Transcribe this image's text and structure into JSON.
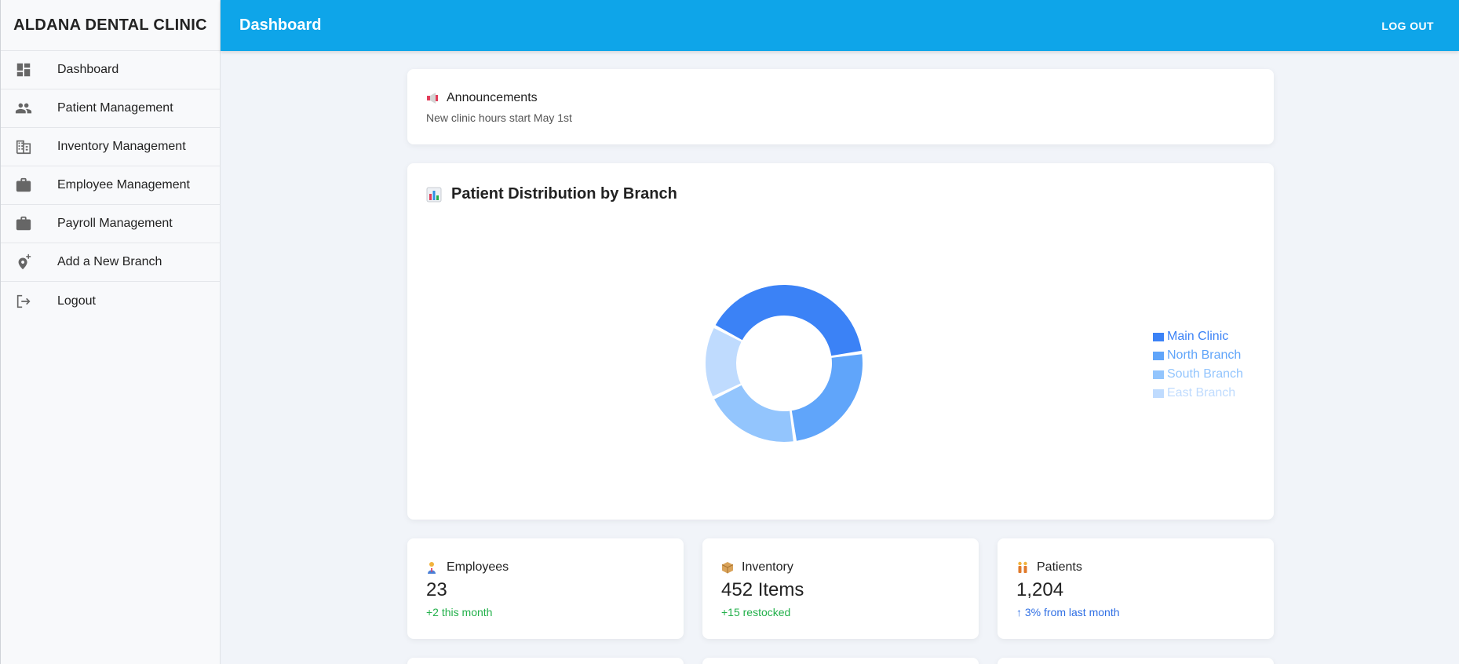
{
  "sidebar": {
    "brand": "ALDANA DENTAL CLINIC",
    "items": [
      {
        "label": "Dashboard",
        "icon": "dashboard-icon"
      },
      {
        "label": "Patient Management",
        "icon": "people-icon"
      },
      {
        "label": "Inventory Management",
        "icon": "building-icon"
      },
      {
        "label": "Employee Management",
        "icon": "briefcase-icon"
      },
      {
        "label": "Payroll Management",
        "icon": "briefcase-icon"
      },
      {
        "label": "Add a New Branch",
        "icon": "add-location-icon"
      },
      {
        "label": "Logout",
        "icon": "logout-icon"
      }
    ]
  },
  "topbar": {
    "title": "Dashboard",
    "logout_label": "LOG OUT",
    "color": "#0ea5e9"
  },
  "announcement": {
    "heading": "Announcements",
    "icon": "megaphone-icon",
    "text": "New clinic hours start May 1st"
  },
  "chart_data": {
    "type": "pie",
    "variant": "donut",
    "title": "Patient Distribution by Branch",
    "categories": [
      "Main Clinic",
      "North Branch",
      "South Branch",
      "East Branch"
    ],
    "values": [
      40,
      25,
      20,
      15
    ],
    "colors": [
      "#3b82f6",
      "#60a5fa",
      "#93c5fd",
      "#bfdbfe"
    ],
    "legend_position": "right"
  },
  "stats": {
    "employees": {
      "label": "Employees",
      "icon": "person-icon",
      "value": "23",
      "sub": "+2 this month",
      "sub_color": "#22b04a"
    },
    "inventory": {
      "label": "Inventory",
      "icon": "package-icon",
      "value": "452 Items",
      "sub": "+15 restocked",
      "sub_color": "#22b04a"
    },
    "patients": {
      "label": "Patients",
      "icon": "people-icon",
      "value": "1,204",
      "sub": "↑ 3% from last month",
      "sub_color": "#2f6fe4"
    }
  }
}
